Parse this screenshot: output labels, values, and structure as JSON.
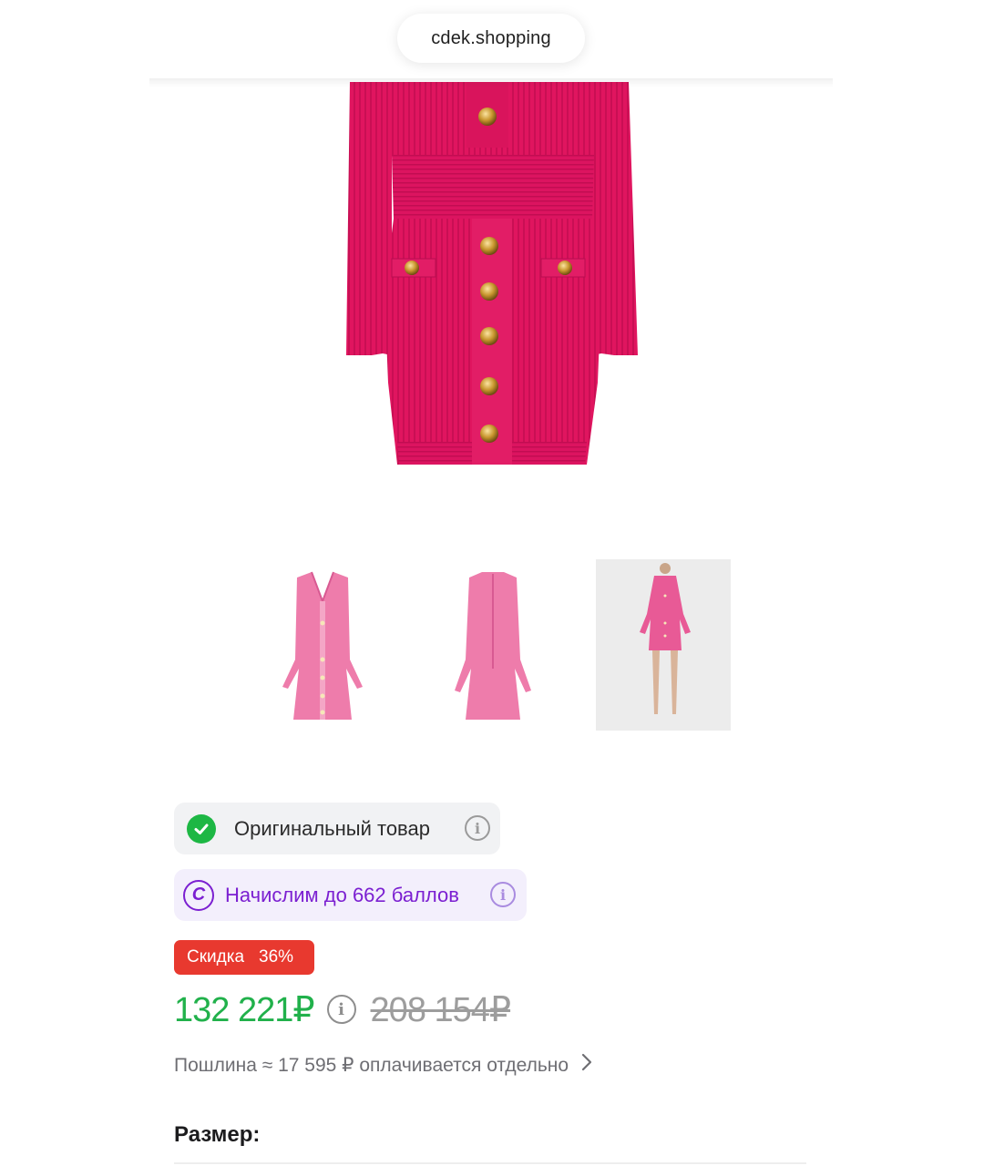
{
  "browser": {
    "url": "cdek.shopping"
  },
  "product": {
    "badges": {
      "original": "Оригинальный товар",
      "points": "Начислим до 662 баллов"
    },
    "discount": {
      "label": "Скидка",
      "percent": "36%"
    },
    "price": {
      "current": "132 221₽",
      "old": "208 154₽"
    },
    "duty": {
      "text": "Пошлина ≈ 17 595 ₽ оплачивается отдельно"
    },
    "size": {
      "title": "Размер:"
    }
  },
  "colors": {
    "dress": "#e0155f",
    "thumb_dress": "#ee7cab",
    "success": "#1db744",
    "price_green": "#21b14b",
    "points_purple": "#7b1fd1",
    "discount_red": "#e8392f"
  },
  "icons": {
    "check": "check-circle-icon",
    "points": "points-coin-icon",
    "info": "info-icon",
    "chevron": "chevron-right-icon"
  }
}
